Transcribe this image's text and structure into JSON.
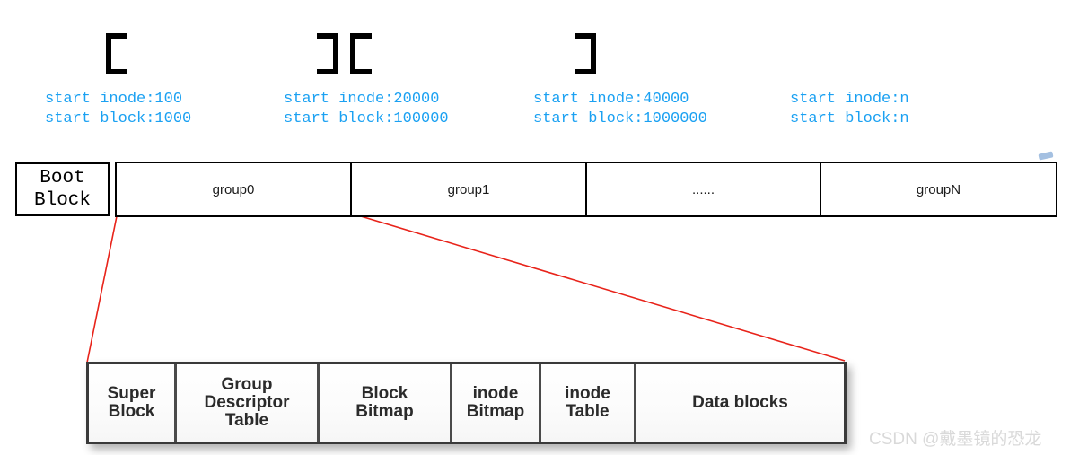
{
  "diagram": {
    "title": "ext2 filesystem block group layout",
    "colors": {
      "annotation_blue": "#1ba1f2",
      "leader_red": "#e8231a",
      "border_black": "#000000",
      "detail_border": "#3a3a3a",
      "watermark_gray": "#d9d9d9"
    },
    "brackets": [
      {
        "name": "bracket-group0-open",
        "type": "["
      },
      {
        "name": "bracket-group0-close",
        "type": "]"
      },
      {
        "name": "bracket-group1-open",
        "type": "["
      },
      {
        "name": "bracket-group1-close",
        "type": "]"
      }
    ],
    "annotations": [
      {
        "inode": "start inode:100",
        "block": "start block:1000"
      },
      {
        "inode": "start inode:20000",
        "block": "start block:100000"
      },
      {
        "inode": "start inode:40000",
        "block": "start block:1000000"
      },
      {
        "inode": "start inode:n",
        "block": "start block:n"
      }
    ],
    "boot_block": {
      "line1": "Boot",
      "line2": "Block"
    },
    "group_table": {
      "cells": [
        {
          "label": "group0"
        },
        {
          "label": "group1"
        },
        {
          "label": "......"
        },
        {
          "label": "groupN"
        }
      ]
    },
    "detail_box": {
      "cells": [
        {
          "lines": [
            "Super",
            "Block"
          ]
        },
        {
          "lines": [
            "Group",
            "Descriptor",
            "Table"
          ]
        },
        {
          "lines": [
            "Block",
            "Bitmap"
          ]
        },
        {
          "lines": [
            "inode",
            "Bitmap"
          ]
        },
        {
          "lines": [
            "inode",
            "Table"
          ]
        },
        {
          "lines": [
            "Data blocks"
          ]
        }
      ]
    },
    "watermark": {
      "text": "CSDN @戴墨镜的恐龙"
    }
  }
}
